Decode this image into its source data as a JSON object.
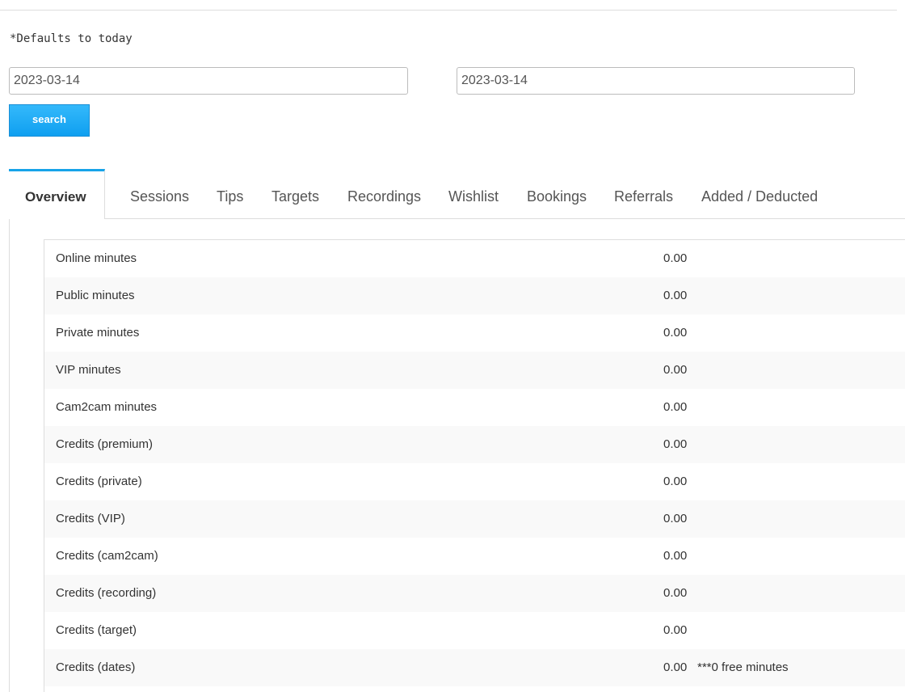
{
  "filter": {
    "note": "*Defaults to today",
    "date_from": "2023-03-14",
    "date_to": "2023-03-14",
    "search_label": "search"
  },
  "tabs": {
    "active": "Overview",
    "items": [
      "Sessions",
      "Tips",
      "Targets",
      "Recordings",
      "Wishlist",
      "Bookings",
      "Referrals",
      "Added / Deducted"
    ]
  },
  "overview": {
    "rows": [
      {
        "label": "Online minutes",
        "value": "0.00",
        "note": ""
      },
      {
        "label": "Public minutes",
        "value": "0.00",
        "note": ""
      },
      {
        "label": "Private minutes",
        "value": "0.00",
        "note": ""
      },
      {
        "label": "VIP minutes",
        "value": "0.00",
        "note": ""
      },
      {
        "label": "Cam2cam minutes",
        "value": "0.00",
        "note": ""
      },
      {
        "label": "Credits (premium)",
        "value": "0.00",
        "note": ""
      },
      {
        "label": "Credits (private)",
        "value": "0.00",
        "note": ""
      },
      {
        "label": "Credits (VIP)",
        "value": "0.00",
        "note": ""
      },
      {
        "label": "Credits (cam2cam)",
        "value": "0.00",
        "note": ""
      },
      {
        "label": "Credits (recording)",
        "value": "0.00",
        "note": ""
      },
      {
        "label": "Credits (target)",
        "value": "0.00",
        "note": ""
      },
      {
        "label": "Credits (dates)",
        "value": "0.00",
        "note": "***0 free minutes"
      }
    ]
  },
  "colors": {
    "accent": "#17a3e8",
    "button": "#0f9ff0",
    "row_alt": "#f9f9f9",
    "border": "#dddddd"
  }
}
